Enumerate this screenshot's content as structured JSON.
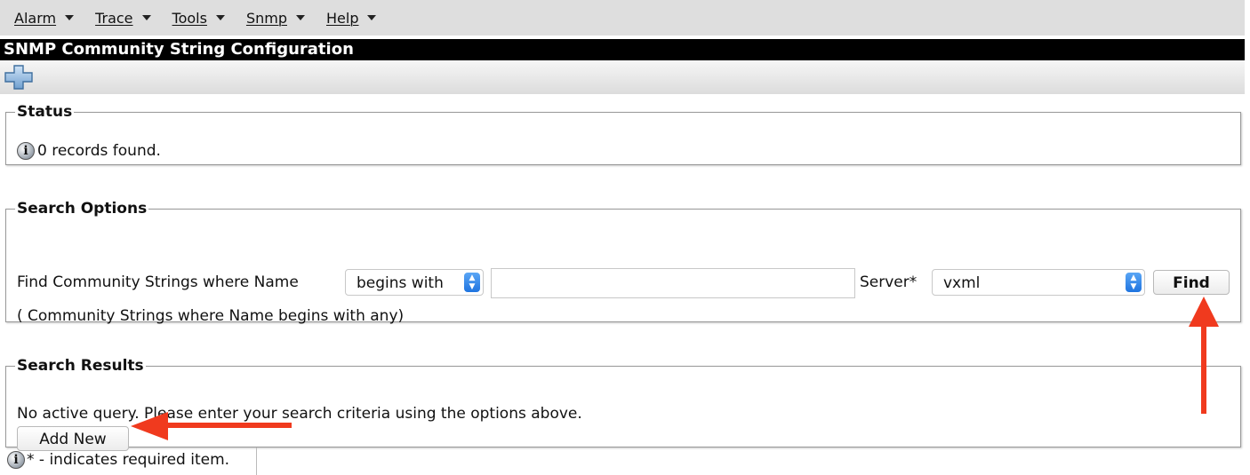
{
  "menu": [
    {
      "label": "Alarm"
    },
    {
      "label": "Trace"
    },
    {
      "label": "Tools"
    },
    {
      "label": "Snmp"
    },
    {
      "label": "Help"
    }
  ],
  "page_title": "SNMP Community String Configuration",
  "toolbar": {
    "add_icon": "plus-icon"
  },
  "status": {
    "legend": "Status",
    "message": "0 records found."
  },
  "search_options": {
    "legend": "Search Options",
    "find_label": "Find Community Strings where Name",
    "match_select": {
      "value": "begins with"
    },
    "search_value": "",
    "server_label": "Server*",
    "server_select": {
      "value": "vxml"
    },
    "find_button": "Find",
    "hint": "( Community Strings where Name begins with any)"
  },
  "search_results": {
    "legend": "Search Results",
    "message": "No active query. Please enter your search criteria using the options above.",
    "add_new_button": "Add New"
  },
  "footer_note": "* - indicates required item.",
  "annotation_color": "#f03a1e",
  "select_spinner_color": "#1f74e0"
}
